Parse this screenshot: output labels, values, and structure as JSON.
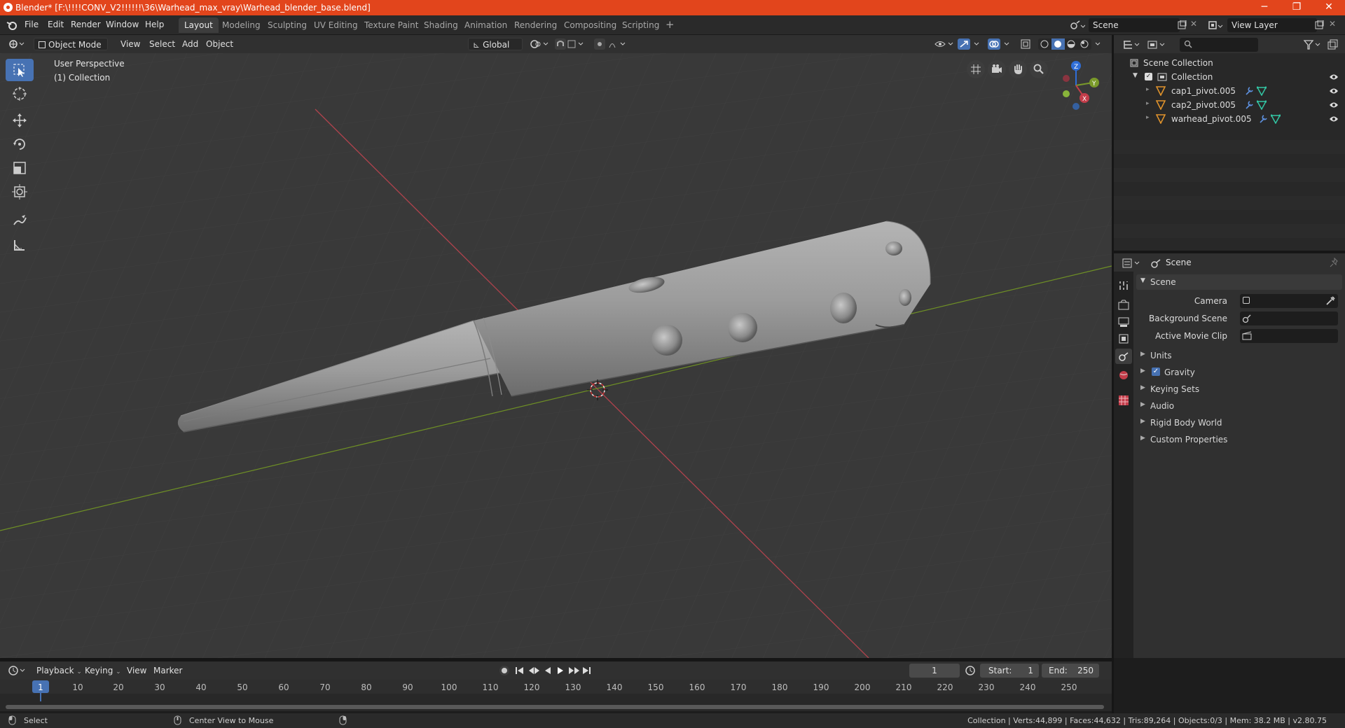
{
  "window": {
    "title": "Blender* [F:\\!!!!CONV_V2!!!!!!\\36\\Warhead_max_vray\\Warhead_blender_base.blend]",
    "minimize": "─",
    "maximize": "❐",
    "close": "✕"
  },
  "menus": [
    "File",
    "Edit",
    "Render",
    "Window",
    "Help"
  ],
  "workspaces": {
    "tabs": [
      "Layout",
      "Modeling",
      "Sculpting",
      "UV Editing",
      "Texture Paint",
      "Shading",
      "Animation",
      "Rendering",
      "Compositing",
      "Scripting"
    ],
    "active": "Layout",
    "add": "+"
  },
  "scene_selector": {
    "value": "Scene"
  },
  "view_layer_selector": {
    "value": "View Layer"
  },
  "viewport_header": {
    "mode": "Object Mode",
    "menus": [
      "View",
      "Select",
      "Add",
      "Object"
    ],
    "orientation": "Global"
  },
  "viewport": {
    "perspective_label": "User Perspective",
    "collection_label": "(1) Collection",
    "gizmo": {
      "x": "X",
      "y": "Y",
      "z": "Z"
    }
  },
  "outliner": {
    "root": "Scene Collection",
    "collection": "Collection",
    "objects": [
      "cap1_pivot.005",
      "cap2_pivot.005",
      "warhead_pivot.005"
    ]
  },
  "properties": {
    "breadcrumb": "Scene",
    "panel_title": "Scene",
    "fields": {
      "camera": "Camera",
      "background_scene": "Background Scene",
      "active_movie_clip": "Active Movie Clip"
    },
    "sections": [
      "Units",
      "Gravity",
      "Keying Sets",
      "Audio",
      "Rigid Body World",
      "Custom Properties"
    ],
    "gravity_checked": true
  },
  "timeline": {
    "menus": [
      "Playback",
      "Keying",
      "View",
      "Marker"
    ],
    "current_frame": "1",
    "start_label": "Start:",
    "start": "1",
    "end_label": "End:",
    "end": "250",
    "ticks": [
      "1",
      "10",
      "20",
      "30",
      "40",
      "50",
      "60",
      "70",
      "80",
      "90",
      "100",
      "110",
      "120",
      "130",
      "140",
      "150",
      "160",
      "170",
      "180",
      "190",
      "200",
      "210",
      "220",
      "230",
      "240",
      "250"
    ]
  },
  "statusbar": {
    "left_action": "Select",
    "middle_action": "Center View to Mouse",
    "stats": "Collection | Verts:44,899 | Faces:44,632 | Tris:89,264 | Objects:0/3 | Mem: 38.2 MB | v2.80.75"
  },
  "colors": {
    "title_bar": "#e2451c",
    "active_tool": "#4772b3",
    "axis_x": "#c33d4a",
    "axis_y": "#7a9a2a",
    "gizmo_z": "#2f6ed8"
  }
}
